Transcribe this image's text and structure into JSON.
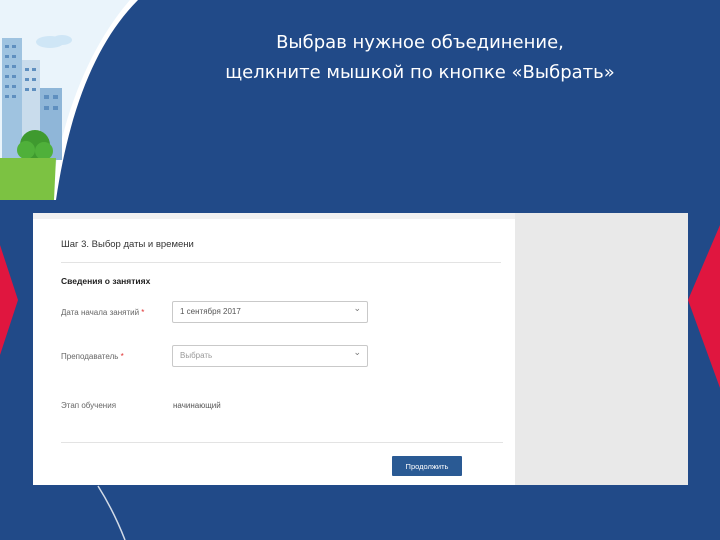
{
  "slide": {
    "caption_line1": "Выбрав нужное объединение,",
    "caption_line2": "щелкните мышкой по кнопке «Выбрать»"
  },
  "form": {
    "step_title": "Шаг 3. Выбор даты и времени",
    "section_title": "Сведения о занятиях",
    "start_date": {
      "label": "Дата начала занятий",
      "value": "1 сентября 2017"
    },
    "teacher": {
      "label": "Преподаватель",
      "value": "Выбрать"
    },
    "status": {
      "label": "Этап обучения",
      "value": "начинающий"
    },
    "required_mark": "*",
    "submit_label": "Продолжить"
  },
  "colors": {
    "background_blue": "#214a88",
    "accent_red": "#e0163f",
    "button_blue": "#2a5a94"
  }
}
